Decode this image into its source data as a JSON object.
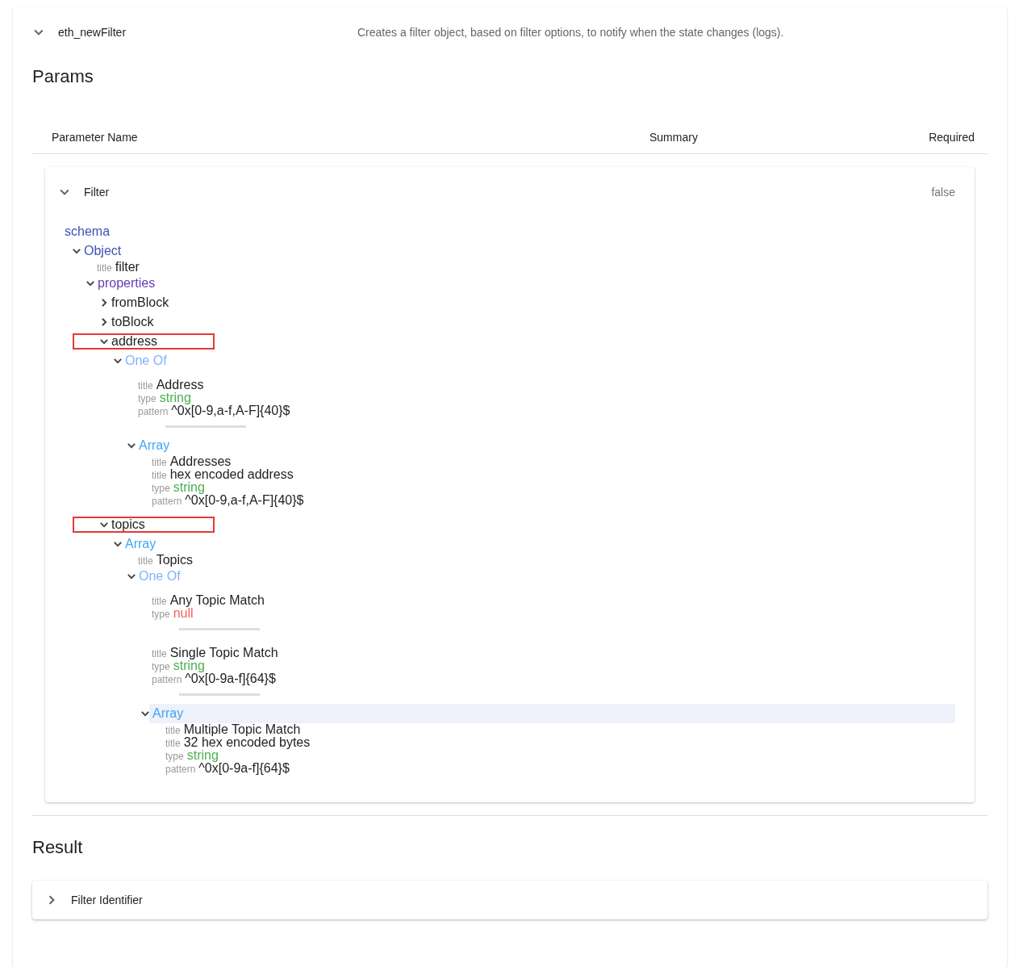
{
  "method": {
    "name": "eth_newFilter",
    "summary": "Creates a filter object, based on filter options, to notify when the state changes (logs).",
    "expanded": true
  },
  "params_heading": "Params",
  "params_columns": [
    "Parameter Name",
    "Summary",
    "Required"
  ],
  "params": [
    {
      "name": "Filter",
      "required": "false",
      "expanded": true,
      "schema": {
        "heading": "schema",
        "tree": [
          {
            "kind": "type",
            "label": "Object",
            "expanded": true,
            "marked": false,
            "highlighted": false,
            "children": [
              {
                "kind": "field",
                "key": "title",
                "value": "filter"
              },
              {
                "kind": "keyword",
                "label": "properties",
                "expanded": true,
                "marked": false,
                "highlighted": false,
                "children": [
                  {
                    "kind": "property",
                    "label": "fromBlock",
                    "expanded": false,
                    "marked": false,
                    "highlighted": false
                  },
                  {
                    "kind": "property",
                    "label": "toBlock",
                    "expanded": false,
                    "marked": false,
                    "highlighted": false
                  },
                  {
                    "kind": "property",
                    "label": "address",
                    "expanded": true,
                    "marked": true,
                    "highlighted": false,
                    "children": [
                      {
                        "kind": "combinator",
                        "label": "One Of",
                        "expanded": true,
                        "marked": false,
                        "highlighted": false,
                        "children": [
                          {
                            "kind": "group",
                            "children": [
                              {
                                "kind": "field",
                                "key": "title",
                                "value": "Address"
                              },
                              {
                                "kind": "string_field",
                                "key": "type",
                                "value": "string"
                              },
                              {
                                "kind": "field",
                                "key": "pattern",
                                "value": "^0x[0-9,a-f,A-F]{40}$"
                              }
                            ]
                          },
                          {
                            "kind": "divider"
                          },
                          {
                            "kind": "array",
                            "label": "Array",
                            "expanded": true,
                            "marked": false,
                            "highlighted": false,
                            "children": [
                              {
                                "kind": "field",
                                "key": "title",
                                "value": "Addresses"
                              },
                              {
                                "kind": "field",
                                "key": "title",
                                "value": "hex encoded address"
                              },
                              {
                                "kind": "string_field",
                                "key": "type",
                                "value": "string"
                              },
                              {
                                "kind": "field",
                                "key": "pattern",
                                "value": "^0x[0-9,a-f,A-F]{40}$"
                              }
                            ]
                          }
                        ]
                      }
                    ]
                  },
                  {
                    "kind": "property",
                    "label": "topics",
                    "expanded": true,
                    "marked": true,
                    "highlighted": false,
                    "children": [
                      {
                        "kind": "array",
                        "label": "Array",
                        "expanded": true,
                        "marked": false,
                        "highlighted": false,
                        "children": [
                          {
                            "kind": "field",
                            "key": "title",
                            "value": "Topics"
                          },
                          {
                            "kind": "combinator",
                            "label": "One Of",
                            "expanded": true,
                            "marked": false,
                            "highlighted": false,
                            "children": [
                              {
                                "kind": "group",
                                "children": [
                                  {
                                    "kind": "field",
                                    "key": "title",
                                    "value": "Any Topic Match"
                                  },
                                  {
                                    "kind": "null_field",
                                    "key": "type",
                                    "value": "null"
                                  }
                                ]
                              },
                              {
                                "kind": "divider"
                              },
                              {
                                "kind": "group",
                                "children": [
                                  {
                                    "kind": "field",
                                    "key": "title",
                                    "value": "Single Topic Match"
                                  },
                                  {
                                    "kind": "string_field",
                                    "key": "type",
                                    "value": "string"
                                  },
                                  {
                                    "kind": "field",
                                    "key": "pattern",
                                    "value": "^0x[0-9a-f]{64}$"
                                  }
                                ]
                              },
                              {
                                "kind": "divider"
                              },
                              {
                                "kind": "array",
                                "label": "Array",
                                "expanded": true,
                                "marked": false,
                                "highlighted": true,
                                "children": [
                                  {
                                    "kind": "field",
                                    "key": "title",
                                    "value": "Multiple Topic Match"
                                  },
                                  {
                                    "kind": "field",
                                    "key": "title",
                                    "value": "32 hex encoded bytes"
                                  },
                                  {
                                    "kind": "string_field",
                                    "key": "type",
                                    "value": "string"
                                  },
                                  {
                                    "kind": "field",
                                    "key": "pattern",
                                    "value": "^0x[0-9a-f]{64}$"
                                  }
                                ]
                              }
                            ]
                          }
                        ]
                      }
                    ]
                  }
                ]
              }
            ]
          }
        ]
      }
    }
  ],
  "result_heading": "Result",
  "result": {
    "name": "Filter Identifier",
    "expanded": false
  }
}
